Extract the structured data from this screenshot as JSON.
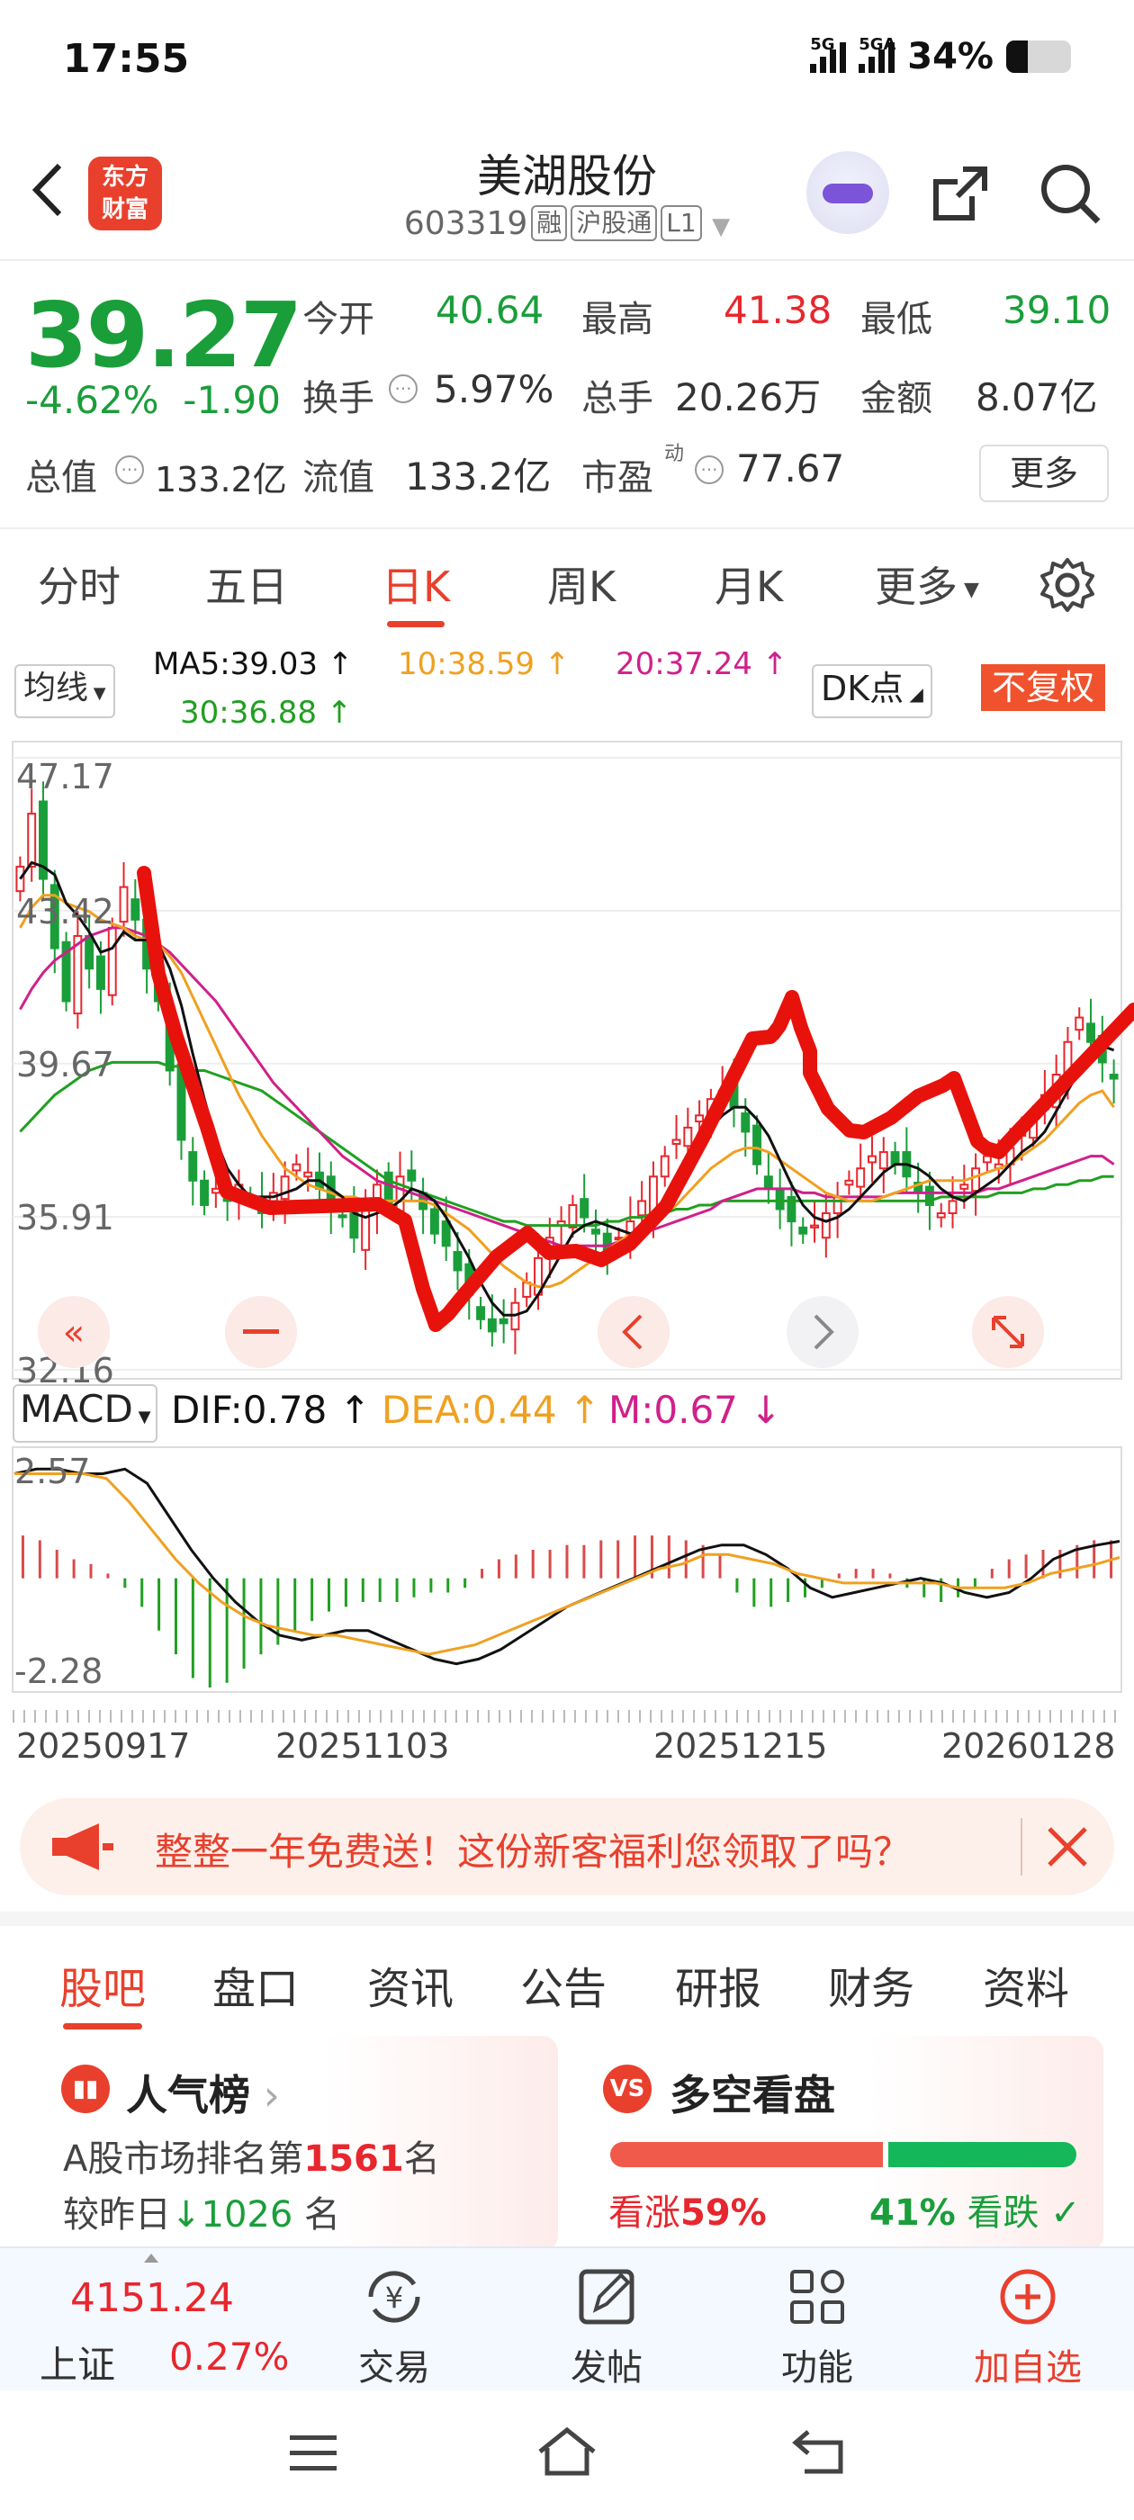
{
  "status": {
    "time": "17:55",
    "sig1": "5G",
    "sig2": "5GA",
    "battery": "34%"
  },
  "header": {
    "logo_line1": "东方",
    "logo_line2": "财富",
    "name": "美湖股份",
    "code": "603319",
    "tags": [
      "融",
      "沪股通",
      "L1"
    ]
  },
  "quote": {
    "price": "39.27",
    "pct": "-4.62%",
    "change": "-1.90",
    "labels": {
      "open": "今开",
      "high": "最高",
      "low": "最低",
      "turnover": "换手",
      "volume": "总手",
      "amount": "金额",
      "mktcap": "总值",
      "float": "流值",
      "pe": "市盈",
      "pe_sup": "动"
    },
    "values": {
      "open": "40.64",
      "high": "41.38",
      "low": "39.10",
      "turnover": "5.97%",
      "volume": "20.26万",
      "amount": "8.07亿",
      "mktcap": "133.2亿",
      "float": "133.2亿",
      "pe": "77.67"
    },
    "more": "更多"
  },
  "ktabs": [
    "分时",
    "五日",
    "日K",
    "周K",
    "月K",
    "更多"
  ],
  "ma": {
    "selector": "均线",
    "ma5": "MA5:39.03 ↑",
    "ma10": "10:38.59 ↑",
    "ma20": "20:37.24 ↑",
    "ma30": "30:36.88 ↑",
    "dk": "DK点",
    "fuquan": "不复权",
    "colors": {
      "ma5": "#111111",
      "ma10": "#f0a020",
      "ma20": "#d0208a",
      "ma30": "#20a020"
    }
  },
  "chart_data": [
    {
      "type": "candlestick",
      "y_ticks": [
        "47.17",
        "43.42",
        "39.67",
        "35.91",
        "32.16"
      ],
      "ylim": [
        32.16,
        47.17
      ],
      "x_labels": [
        "20250917",
        "20251103",
        "20251215",
        "20260128"
      ],
      "closes": [
        44.5,
        45.8,
        44.2,
        42.5,
        41.2,
        42.8,
        42.0,
        41.5,
        43.0,
        44.0,
        43.2,
        42.0,
        41.2,
        39.5,
        37.8,
        36.8,
        36.2,
        36.6,
        36.3,
        36.7,
        36.4,
        36.0,
        36.5,
        36.9,
        37.2,
        37.0,
        36.6,
        36.1,
        35.9,
        35.4,
        36.1,
        36.7,
        36.2,
        36.9,
        36.8,
        36.1,
        35.5,
        35.2,
        34.6,
        34.0,
        33.4,
        33.1,
        33.3,
        33.8,
        34.3,
        34.9,
        35.4,
        35.8,
        36.2,
        35.9,
        35.5,
        35.1,
        35.4,
        35.8,
        36.3,
        36.9,
        37.4,
        37.8,
        38.1,
        38.4,
        38.8,
        39.0,
        38.6,
        38.0,
        37.2,
        36.6,
        36.1,
        35.8,
        35.5,
        35.7,
        36.0,
        36.4,
        36.8,
        37.1,
        37.4,
        37.5,
        37.2,
        36.9,
        36.5,
        36.2,
        36.0,
        36.3,
        36.7,
        37.1,
        37.4,
        37.2,
        37.6,
        38.0,
        38.4,
        38.9,
        39.4,
        40.2,
        40.8,
        40.2,
        39.7,
        39.3
      ],
      "ma5": [
        44.2,
        44.6,
        44.5,
        44.3,
        43.6,
        43.3,
        42.9,
        42.4,
        42.5,
        42.9,
        42.7,
        42.7,
        42.6,
        42.0,
        41.1,
        39.9,
        38.8,
        37.8,
        37.1,
        36.7,
        36.4,
        36.4,
        36.4,
        36.5,
        36.6,
        36.8,
        36.8,
        36.6,
        36.4,
        36.0,
        35.9,
        36.0,
        36.1,
        36.3,
        36.6,
        36.5,
        36.3,
        35.9,
        35.4,
        34.9,
        34.3,
        33.8,
        33.5,
        33.5,
        33.6,
        34.0,
        34.5,
        35.0,
        35.5,
        35.7,
        35.8,
        35.7,
        35.6,
        35.5,
        35.6,
        35.9,
        36.3,
        36.8,
        37.3,
        37.7,
        38.1,
        38.4,
        38.6,
        38.6,
        38.3,
        37.9,
        37.3,
        36.7,
        36.2,
        35.9,
        35.8,
        35.9,
        36.1,
        36.4,
        36.7,
        37.0,
        37.2,
        37.2,
        37.1,
        36.9,
        36.6,
        36.4,
        36.3,
        36.5,
        36.7,
        36.9,
        37.2,
        37.5,
        37.7,
        38.0,
        38.5,
        39.0,
        39.5,
        39.9,
        40.1,
        40.0
      ],
      "ma10": [
        43.0,
        43.5,
        43.8,
        43.8,
        43.6,
        43.5,
        43.4,
        43.2,
        43.1,
        43.0,
        42.8,
        42.7,
        42.6,
        42.3,
        41.9,
        41.3,
        40.7,
        40.1,
        39.5,
        38.9,
        38.4,
        37.9,
        37.5,
        37.1,
        36.9,
        36.7,
        36.6,
        36.5,
        36.4,
        36.4,
        36.3,
        36.3,
        36.3,
        36.3,
        36.3,
        36.3,
        36.2,
        36.0,
        35.8,
        35.6,
        35.3,
        35.0,
        34.7,
        34.5,
        34.3,
        34.2,
        34.2,
        34.3,
        34.5,
        34.7,
        34.9,
        35.1,
        35.3,
        35.5,
        35.6,
        35.8,
        36.0,
        36.2,
        36.5,
        36.8,
        37.1,
        37.3,
        37.5,
        37.6,
        37.6,
        37.5,
        37.3,
        37.1,
        36.9,
        36.7,
        36.5,
        36.4,
        36.3,
        36.3,
        36.3,
        36.4,
        36.5,
        36.6,
        36.7,
        36.8,
        36.8,
        36.8,
        36.8,
        36.9,
        37.0,
        37.1,
        37.2,
        37.4,
        37.6,
        37.8,
        38.1,
        38.4,
        38.7,
        38.9,
        39.0,
        38.6
      ],
      "ma20": [
        41.0,
        41.5,
        41.9,
        42.2,
        42.4,
        42.6,
        42.8,
        42.9,
        43.0,
        43.0,
        42.9,
        42.8,
        42.6,
        42.4,
        42.1,
        41.8,
        41.5,
        41.2,
        40.8,
        40.4,
        40.0,
        39.6,
        39.2,
        38.9,
        38.6,
        38.3,
        38.0,
        37.7,
        37.4,
        37.2,
        37.0,
        36.8,
        36.7,
        36.6,
        36.5,
        36.4,
        36.3,
        36.2,
        36.1,
        36.0,
        35.9,
        35.8,
        35.7,
        35.6,
        35.5,
        35.4,
        35.3,
        35.2,
        35.2,
        35.2,
        35.2,
        35.2,
        35.3,
        35.4,
        35.5,
        35.6,
        35.7,
        35.8,
        35.9,
        36.0,
        36.1,
        36.3,
        36.4,
        36.5,
        36.6,
        36.6,
        36.6,
        36.6,
        36.5,
        36.5,
        36.4,
        36.4,
        36.4,
        36.4,
        36.4,
        36.4,
        36.5,
        36.5,
        36.5,
        36.5,
        36.5,
        36.5,
        36.5,
        36.5,
        36.6,
        36.6,
        36.7,
        36.8,
        36.9,
        37.0,
        37.1,
        37.2,
        37.3,
        37.4,
        37.4,
        37.2
      ],
      "ma30": [
        38.0,
        38.3,
        38.6,
        38.9,
        39.1,
        39.3,
        39.5,
        39.6,
        39.7,
        39.7,
        39.7,
        39.7,
        39.7,
        39.6,
        39.6,
        39.5,
        39.5,
        39.4,
        39.3,
        39.2,
        39.1,
        39.0,
        38.8,
        38.6,
        38.4,
        38.2,
        38.0,
        37.8,
        37.6,
        37.4,
        37.2,
        37.0,
        36.8,
        36.7,
        36.6,
        36.5,
        36.4,
        36.3,
        36.2,
        36.1,
        36.0,
        35.9,
        35.8,
        35.8,
        35.7,
        35.7,
        35.7,
        35.7,
        35.7,
        35.7,
        35.7,
        35.8,
        35.8,
        35.9,
        35.9,
        36.0,
        36.0,
        36.1,
        36.1,
        36.2,
        36.2,
        36.3,
        36.3,
        36.3,
        36.3,
        36.3,
        36.3,
        36.3,
        36.3,
        36.3,
        36.3,
        36.3,
        36.3,
        36.3,
        36.3,
        36.3,
        36.3,
        36.3,
        36.3,
        36.3,
        36.4,
        36.4,
        36.4,
        36.4,
        36.4,
        36.5,
        36.5,
        36.5,
        36.6,
        36.6,
        36.7,
        36.7,
        36.8,
        36.8,
        36.9,
        36.9
      ]
    },
    {
      "type": "bar",
      "indicator": "MACD",
      "dif_label": "DIF:0.78 ↑",
      "dea_label": "DEA:0.44 ↑",
      "m_label": "M:0.67 ↓",
      "y_ticks": [
        "2.57",
        "-2.28"
      ],
      "ylim": [
        -2.28,
        2.57
      ],
      "hist": [
        0.9,
        0.8,
        0.6,
        0.4,
        0.3,
        0.1,
        -0.2,
        -0.6,
        -1.1,
        -1.6,
        -2.1,
        -2.3,
        -2.2,
        -1.9,
        -1.6,
        -1.4,
        -1.1,
        -0.9,
        -0.7,
        -0.6,
        -0.5,
        -0.5,
        -0.5,
        -0.4,
        -0.3,
        -0.3,
        -0.2,
        0.2,
        0.4,
        0.5,
        0.6,
        0.6,
        0.7,
        0.7,
        0.8,
        0.8,
        0.9,
        0.9,
        0.9,
        0.8,
        0.7,
        0.5,
        -0.3,
        -0.6,
        -0.6,
        -0.5,
        -0.4,
        -0.2,
        0.1,
        0.2,
        0.2,
        0.1,
        -0.2,
        -0.4,
        -0.5,
        -0.4,
        -0.2,
        0.2,
        0.4,
        0.5,
        0.6,
        0.6,
        0.7,
        0.8,
        0.8
      ],
      "dif": [
        2.2,
        2.3,
        2.3,
        2.2,
        2.2,
        2.3,
        2.0,
        1.3,
        0.6,
        0.0,
        -0.5,
        -0.9,
        -1.2,
        -1.3,
        -1.2,
        -1.1,
        -1.1,
        -1.3,
        -1.5,
        -1.7,
        -1.8,
        -1.7,
        -1.5,
        -1.2,
        -0.9,
        -0.6,
        -0.4,
        -0.2,
        0.0,
        0.2,
        0.4,
        0.6,
        0.7,
        0.7,
        0.5,
        0.2,
        -0.2,
        -0.4,
        -0.3,
        -0.2,
        -0.1,
        0.0,
        -0.1,
        -0.3,
        -0.4,
        -0.3,
        0.0,
        0.4,
        0.6,
        0.7,
        0.78
      ],
      "dea": [
        2.2,
        2.2,
        2.2,
        2.2,
        2.1,
        1.6,
        1.0,
        0.4,
        -0.1,
        -0.5,
        -0.8,
        -1.0,
        -1.1,
        -1.2,
        -1.2,
        -1.3,
        -1.4,
        -1.5,
        -1.6,
        -1.5,
        -1.4,
        -1.2,
        -1.0,
        -0.8,
        -0.6,
        -0.4,
        -0.2,
        0.0,
        0.2,
        0.3,
        0.5,
        0.5,
        0.4,
        0.3,
        0.1,
        0.0,
        -0.1,
        -0.1,
        -0.1,
        -0.1,
        -0.1,
        -0.2,
        -0.2,
        -0.2,
        -0.1,
        0.1,
        0.2,
        0.3,
        0.44
      ],
      "colors": {
        "pos": "#d94a4a",
        "neg": "#20a020",
        "dif": "#111111",
        "dea": "#f0a020"
      }
    }
  ],
  "macd": {
    "selector": "MACD"
  },
  "banner": {
    "text": "整整一年免费送！这份新客福利您领取了吗？"
  },
  "tabs2": [
    "股吧",
    "盘口",
    "资讯",
    "公告",
    "研报",
    "财务",
    "资料"
  ],
  "popularity": {
    "title": "人气榜",
    "line1_prefix": "A股市场排名第",
    "rank": "1561",
    "line1_suffix": "名",
    "line2_prefix": "较昨日",
    "delta": "1026",
    "line2_suffix": "名"
  },
  "sentiment": {
    "title": "多空看盘",
    "icon": "VS",
    "bull_label": "看涨",
    "bull_pct": "59%",
    "bear_pct": "41%",
    "bear_label": "看跌",
    "bull_fraction": 0.59
  },
  "index": {
    "value": "4151.24",
    "name": "上证",
    "pct": "0.27%"
  },
  "bottom_nav": [
    "交易",
    "发帖",
    "功能",
    "加自选"
  ]
}
